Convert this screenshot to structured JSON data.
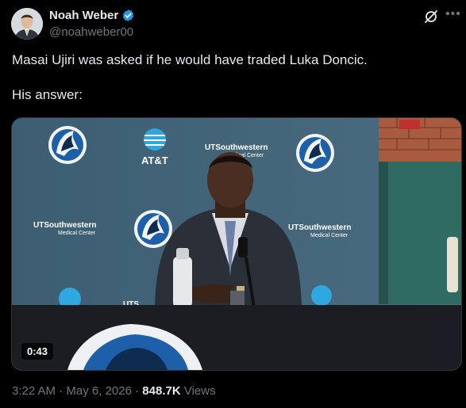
{
  "author": {
    "name": "Noah Weber",
    "handle": "@noahweber00"
  },
  "tweet": {
    "line1": "Masai Ujiri was asked if he would have traded Luka Doncic.",
    "line2": "His answer:"
  },
  "media": {
    "duration": "0:43",
    "backdrop_labels": {
      "sponsor_att": "AT&T",
      "sponsor_ut": "UTSouthwestern",
      "sponsor_ut_sub": "Medical Center",
      "table_text": "UTS"
    }
  },
  "meta": {
    "time": "3:22 AM",
    "date": "May 6, 2026",
    "views_count": "848.7K",
    "views_label": "Views",
    "separator": "·"
  },
  "colors": {
    "background": "#000000",
    "text_primary": "#e7e9ea",
    "text_secondary": "#71767b",
    "verified_blue": "#1d9bf0"
  }
}
